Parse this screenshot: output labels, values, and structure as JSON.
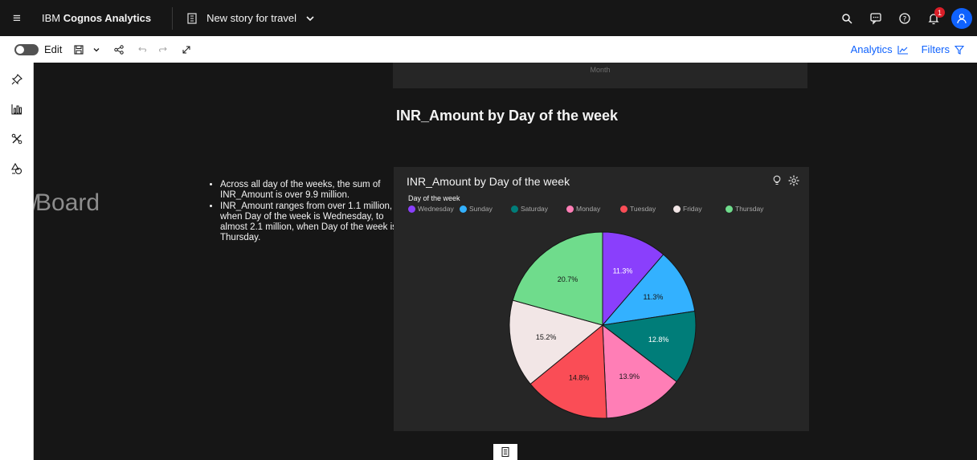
{
  "app": {
    "brand_regular": "IBM ",
    "brand_bold": "Cognos Analytics",
    "story_title": "New story for travel",
    "notification_count": "1"
  },
  "toolbar": {
    "edit_label": "Edit",
    "analytics_label": "Analytics",
    "filters_label": "Filters"
  },
  "canvas": {
    "previous_card_label": "Month",
    "board_fragment": "Board",
    "insights": [
      "Across all day of the weeks, the sum of INR_Amount is over 9.9 million.",
      "INR_Amount ranges from over 1.1 million, when Day of the week is Wednesday, to almost 2.1 million, when Day of the week is Thursday."
    ],
    "section_title": "INR_Amount by Day of the week"
  },
  "chart_data": {
    "type": "pie",
    "title": "INR_Amount by Day of the week",
    "legend_title": "Day of the week",
    "legend_position": "top-left",
    "categories": [
      "Wednesday",
      "Sunday",
      "Saturday",
      "Monday",
      "Tuesday",
      "Friday",
      "Thursday"
    ],
    "values": [
      11.3,
      11.3,
      12.8,
      13.9,
      14.8,
      15.2,
      20.7
    ],
    "labels": [
      "11.3%",
      "11.3%",
      "12.8%",
      "13.9%",
      "14.8%",
      "15.2%",
      "20.7%"
    ],
    "colors": [
      "#8a3ffc",
      "#33b1ff",
      "#007d79",
      "#ff7eb6",
      "#fa4d56",
      "#f2e6e6",
      "#6fdc8c"
    ],
    "label_colors": [
      "#ffffff",
      "#161616",
      "#ffffff",
      "#161616",
      "#161616",
      "#161616",
      "#161616"
    ]
  },
  "icons": {
    "menu": "hamburger-icon",
    "search": "search-icon",
    "chat": "chat-icon",
    "help": "help-icon",
    "notifications": "bell-icon",
    "user": "user-icon",
    "pin": "pin-icon",
    "visualizations": "bar-chart-icon",
    "tools": "tools-icon",
    "media": "shapes-icon",
    "insight": "lightbulb-icon",
    "settings": "settings-icon"
  }
}
